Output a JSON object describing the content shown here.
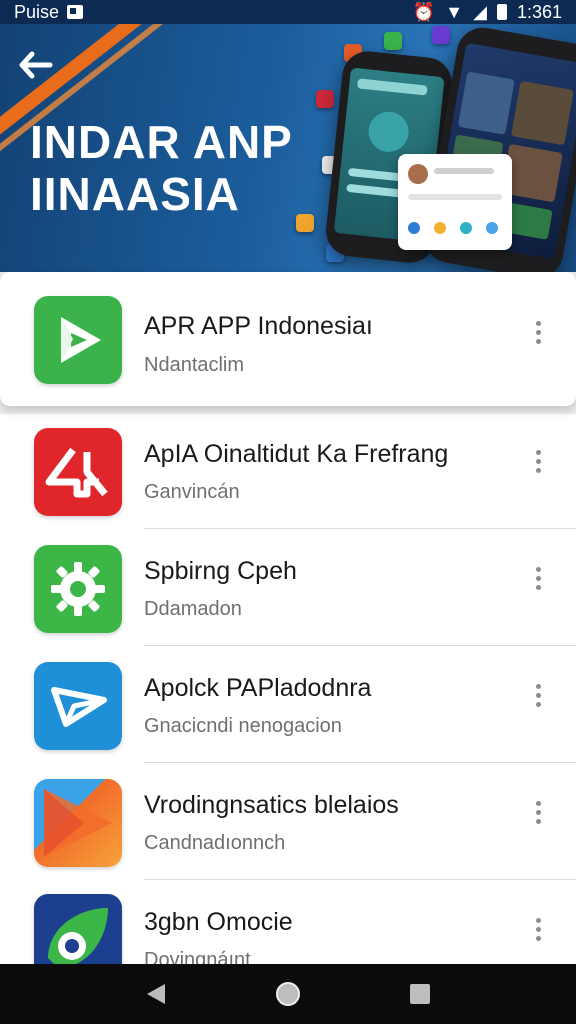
{
  "status_bar": {
    "carrier": "Puise",
    "time": "1:361"
  },
  "hero": {
    "title_line1": "INDAR ANP",
    "title_line2": "IINAASIA"
  },
  "featured_app": {
    "title": "APR APP Indonesiaı",
    "subtitle": "Ndantaclim",
    "icon": "play-triangle-icon",
    "icon_color": "#3bb34a"
  },
  "apps": [
    {
      "title": "ApIA Oinaltidut Ka Frefrang",
      "subtitle": "Ganvincán",
      "icon": "ap-logo-icon",
      "icon_color": "#e0262b"
    },
    {
      "title": "Spbirng Cpeh",
      "subtitle": "Ddamadon",
      "icon": "gear-icon",
      "icon_color": "#3db648"
    },
    {
      "title": "Apolck PAPladodnra",
      "subtitle": "Gnacicndi nenogacion",
      "icon": "paper-plane-icon",
      "icon_color": "#1f8fd8"
    },
    {
      "title": "Vrodingnsatics blelaios",
      "subtitle": "Candnadıonnch",
      "icon": "play-arrow-icon",
      "icon_color": "#f26b2a"
    },
    {
      "title": "3gbn Omocie",
      "subtitle": "Dovingnáınt",
      "icon": "eye-icon",
      "icon_color": "#1c3f8f"
    }
  ],
  "colors": {
    "hero_blue": "#1b5d9c",
    "accent_orange": "#e96c1b",
    "navbar": "#0b0b0b"
  }
}
